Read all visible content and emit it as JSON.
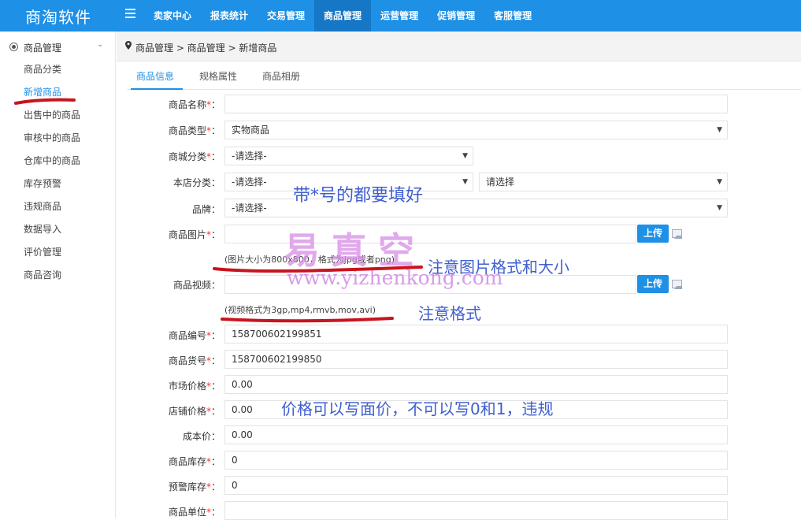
{
  "brand": "商淘软件",
  "nav": [
    "卖家中心",
    "报表统计",
    "交易管理",
    "商品管理",
    "运营管理",
    "促销管理",
    "客服管理"
  ],
  "nav_active": "商品管理",
  "sidebar": {
    "header": "商品管理",
    "items": [
      "商品分类",
      "新增商品",
      "出售中的商品",
      "审核中的商品",
      "仓库中的商品",
      "库存预警",
      "违规商品",
      "数据导入",
      "评价管理",
      "商品咨询"
    ],
    "active": "新增商品"
  },
  "breadcrumb": "商品管理 > 商品管理 > 新增商品",
  "tabs": [
    "商品信息",
    "规格属性",
    "商品相册"
  ],
  "form": {
    "name_label": "商品名称",
    "type_label": "商品类型",
    "type_value": "实物商品",
    "mall_cat_label": "商城分类",
    "mall_cat_value": "-请选择-",
    "shop_cat_label": "本店分类",
    "shop_cat_value": "-请选择-",
    "shop_cat_value2": "请选择",
    "brand_label": "品牌",
    "brand_value": "-请选择-",
    "image_label": "商品图片",
    "upload_label": "上传",
    "image_hint": "(图片大小为800x800，格式为jpg或者png)",
    "video_label": "商品视频",
    "video_hint": "(视频格式为3gp,mp4,rmvb,mov,avi)",
    "sn_label": "商品编号",
    "sn_value": "158700602199851",
    "goods_no_label": "商品货号",
    "goods_no_value": "158700602199850",
    "market_price_label": "市场价格",
    "market_price_value": "0.00",
    "shop_price_label": "店铺价格",
    "shop_price_value": "0.00",
    "cost_label": "成本价",
    "cost_value": "0.00",
    "stock_label": "商品库存",
    "stock_value": "0",
    "warn_label": "预警库存",
    "warn_value": "0",
    "unit_label": "商品单位",
    "required_mark": "*",
    "colon": "："
  },
  "annotations": {
    "required_note": "带*号的都要填好",
    "image_note": "注意图片格式和大小",
    "video_note": "注意格式",
    "price_note": "价格可以写面价，不可以写0和1，违规"
  },
  "watermark": {
    "text": "易真空",
    "url": "www.yizhenkong.com"
  },
  "colors": {
    "primary": "#1e90e6",
    "annotation": "#3f5fcf",
    "scribble": "#c8141e"
  }
}
